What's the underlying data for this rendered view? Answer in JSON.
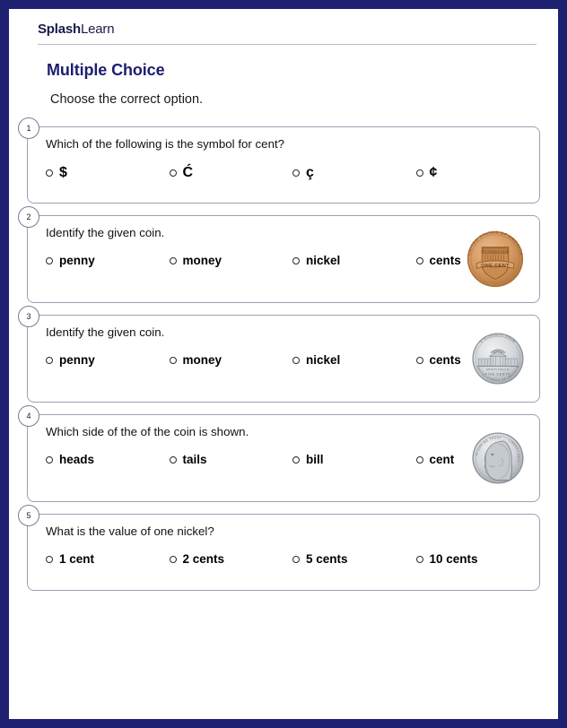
{
  "brand": {
    "bold": "Splash",
    "light": "Learn"
  },
  "header": {
    "title": "Multiple Choice",
    "subtitle": "Choose the correct option."
  },
  "colors": {
    "page_border": "#1e2171",
    "title": "#1d1d72",
    "card_border": "#9f9fb5",
    "penny": "#c8833f",
    "nickel": "#b9bcc0"
  },
  "questions": [
    {
      "number": "1",
      "text": "Which of the following is the symbol for cent?",
      "options": [
        "$",
        "Ć",
        "ç",
        "¢"
      ],
      "coin": null
    },
    {
      "number": "2",
      "text": "Identify the given coin.",
      "options": [
        "penny",
        "money",
        "nickel",
        "cents"
      ],
      "coin": "penny-reverse",
      "coin_text": {
        "outer": "UNITED STATES OF AMERICA",
        "motto": "E PLURIBUS UNUM",
        "value": "ONE CENT"
      }
    },
    {
      "number": "3",
      "text": "Identify the given coin.",
      "options": [
        "penny",
        "money",
        "nickel",
        "cents"
      ],
      "coin": "nickel-reverse",
      "coin_text": {
        "outer": "UNITED STATES OF AMERICA",
        "motto": "E PLURIBUS UNUM",
        "building": "MONTICELLO",
        "value": "FIVE CENTS"
      }
    },
    {
      "number": "4",
      "text": "Which side of the of the coin is shown.",
      "options": [
        "heads",
        "tails",
        "bill",
        "cent"
      ],
      "coin": "nickel-obverse",
      "coin_text": {
        "motto": "IN GOD WE TRUST",
        "liberty": "LIBERTY",
        "year": "2003"
      }
    },
    {
      "number": "5",
      "text": "What is the value of one nickel?",
      "options": [
        "1 cent",
        "2 cents",
        "5 cents",
        "10 cents"
      ],
      "coin": null
    }
  ]
}
